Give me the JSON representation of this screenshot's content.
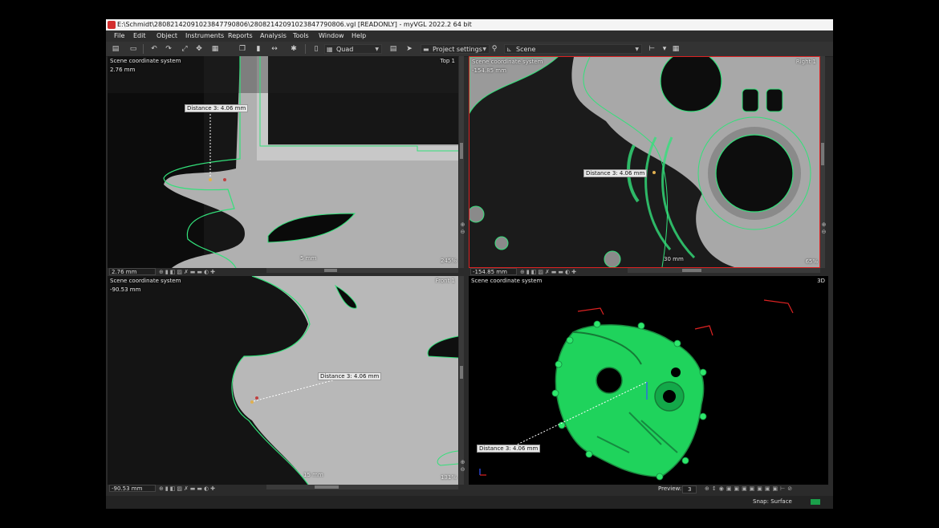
{
  "window": {
    "title": "E:\\Schmidt\\28082142091023847790806\\28082142091023847790806.vgl [READONLY] - myVGL 2022.2 64 bit"
  },
  "menu": [
    "File",
    "Edit",
    "Object",
    "Instruments",
    "Reports",
    "Analysis",
    "Tools",
    "Window",
    "Help"
  ],
  "toolbar": {
    "layout_combo": "Quad",
    "settings_combo": "Project settings",
    "scene_combo": "Scene"
  },
  "viewports": {
    "top": {
      "system": "Scene coordinate system",
      "name": "Top 1",
      "position": "2.76 mm",
      "zoom": "245%",
      "scale": "5 mm",
      "coord_field": "2.76 mm"
    },
    "right": {
      "system": "Scene coordinate system",
      "name": "Right 1",
      "position": "-154.85 mm",
      "zoom": "65%",
      "scale": "30 mm",
      "coord_field": "-154.85 mm"
    },
    "front": {
      "system": "Scene coordinate system",
      "name": "Front 1",
      "position": "-90.53 mm",
      "zoom": "131%",
      "scale": "15 mm",
      "coord_field": "-90.53 mm"
    },
    "three_d": {
      "system": "Scene coordinate system",
      "name": "3D"
    }
  },
  "measurement": {
    "label": "Distance 3: 4.06 mm"
  },
  "preview": {
    "label": "Preview:",
    "value": "3"
  },
  "status": {
    "snap": "Snap: Surface"
  },
  "colors": {
    "outline": "#33e07a",
    "part": "#1fd35c",
    "selection": "#dd2222"
  }
}
